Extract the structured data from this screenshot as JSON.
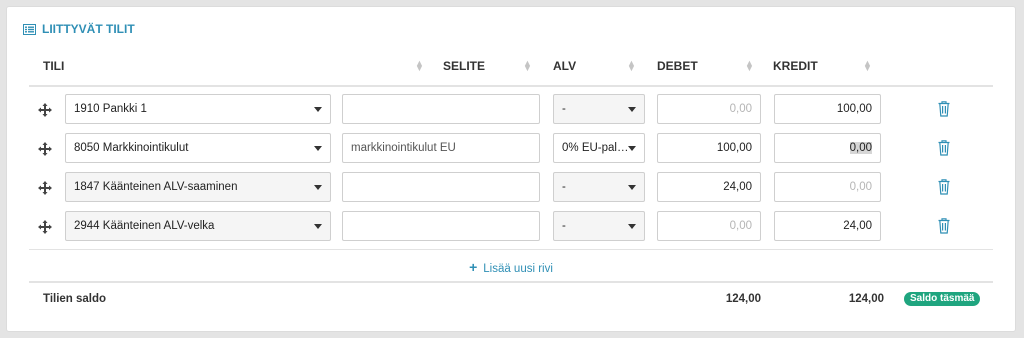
{
  "section": {
    "title": "LIITTYVÄT TILIT",
    "icon": "list-icon"
  },
  "columns": {
    "tili": "TILI",
    "selite": "SELITE",
    "alv": "ALV",
    "debet": "DEBET",
    "kredit": "KREDIT"
  },
  "rows": [
    {
      "account": "1910 Pankki 1",
      "description": "",
      "vat": "-",
      "debit": "0,00",
      "credit": "100,00"
    },
    {
      "account": "8050 Markkinointikulut",
      "description": "markkinointikulut EU",
      "vat": "0% EU-pal…",
      "debit": "100,00",
      "credit": "0,00"
    },
    {
      "account": "1847 Käänteinen ALV-saaminen",
      "description": "",
      "vat": "-",
      "debit": "24,00",
      "credit": "0,00"
    },
    {
      "account": "2944 Käänteinen ALV-velka",
      "description": "",
      "vat": "-",
      "debit": "0,00",
      "credit": "24,00"
    }
  ],
  "add_row_label": "Lisää uusi rivi",
  "summary": {
    "label": "Tilien saldo",
    "debit_total": "124,00",
    "credit_total": "124,00",
    "status_badge": "Saldo täsmää"
  },
  "colors": {
    "accent": "#2f8fb5",
    "success": "#1fa57f"
  }
}
